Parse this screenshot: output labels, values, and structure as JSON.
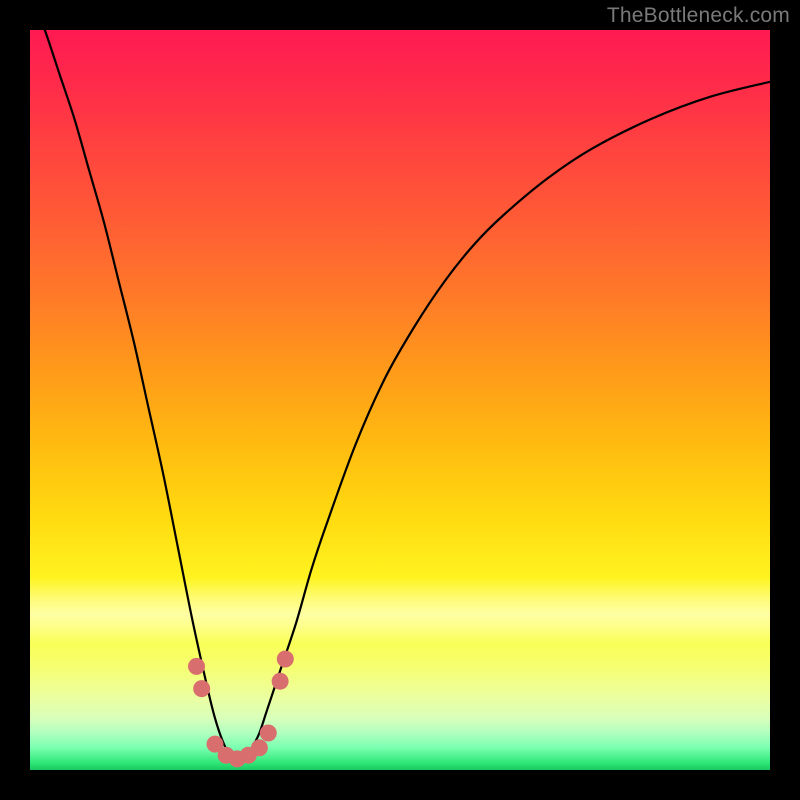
{
  "watermark": "TheBottleneck.com",
  "colors": {
    "frame": "#000000",
    "curve": "#000000",
    "marker": "#d96e6e",
    "gradient_top": "#ff1a52",
    "gradient_bottom": "#18c860"
  },
  "chart_data": {
    "type": "line",
    "title": "",
    "xlabel": "",
    "ylabel": "",
    "xlim": [
      0,
      100
    ],
    "ylim": [
      0,
      100
    ],
    "grid": false,
    "legend": false,
    "notes": "V-shaped bottleneck curve over vertical red→yellow→green gradient; minimum near x≈28. No axis tick labels rendered.",
    "series": [
      {
        "name": "bottleneck-curve",
        "x": [
          0,
          2,
          4,
          6,
          8,
          10,
          12,
          14,
          16,
          18,
          20,
          22,
          24,
          25,
          26,
          27,
          28,
          29,
          30,
          31,
          32,
          34,
          36,
          38,
          40,
          44,
          48,
          52,
          56,
          60,
          64,
          70,
          76,
          84,
          92,
          100
        ],
        "y": [
          105,
          100,
          94,
          88,
          81,
          74,
          66,
          58,
          49,
          40,
          30,
          20,
          11,
          7,
          4,
          2,
          1,
          1.5,
          3,
          5,
          8,
          14,
          20,
          27,
          33,
          44,
          53,
          60,
          66,
          71,
          75,
          80,
          84,
          88,
          91,
          93
        ]
      }
    ],
    "markers": [
      {
        "x": 22.5,
        "y": 14
      },
      {
        "x": 23.2,
        "y": 11
      },
      {
        "x": 25.0,
        "y": 3.5
      },
      {
        "x": 26.5,
        "y": 2.0
      },
      {
        "x": 28.0,
        "y": 1.5
      },
      {
        "x": 29.5,
        "y": 2.0
      },
      {
        "x": 31.0,
        "y": 3.0
      },
      {
        "x": 32.2,
        "y": 5.0
      },
      {
        "x": 33.8,
        "y": 12
      },
      {
        "x": 34.5,
        "y": 15
      }
    ]
  }
}
